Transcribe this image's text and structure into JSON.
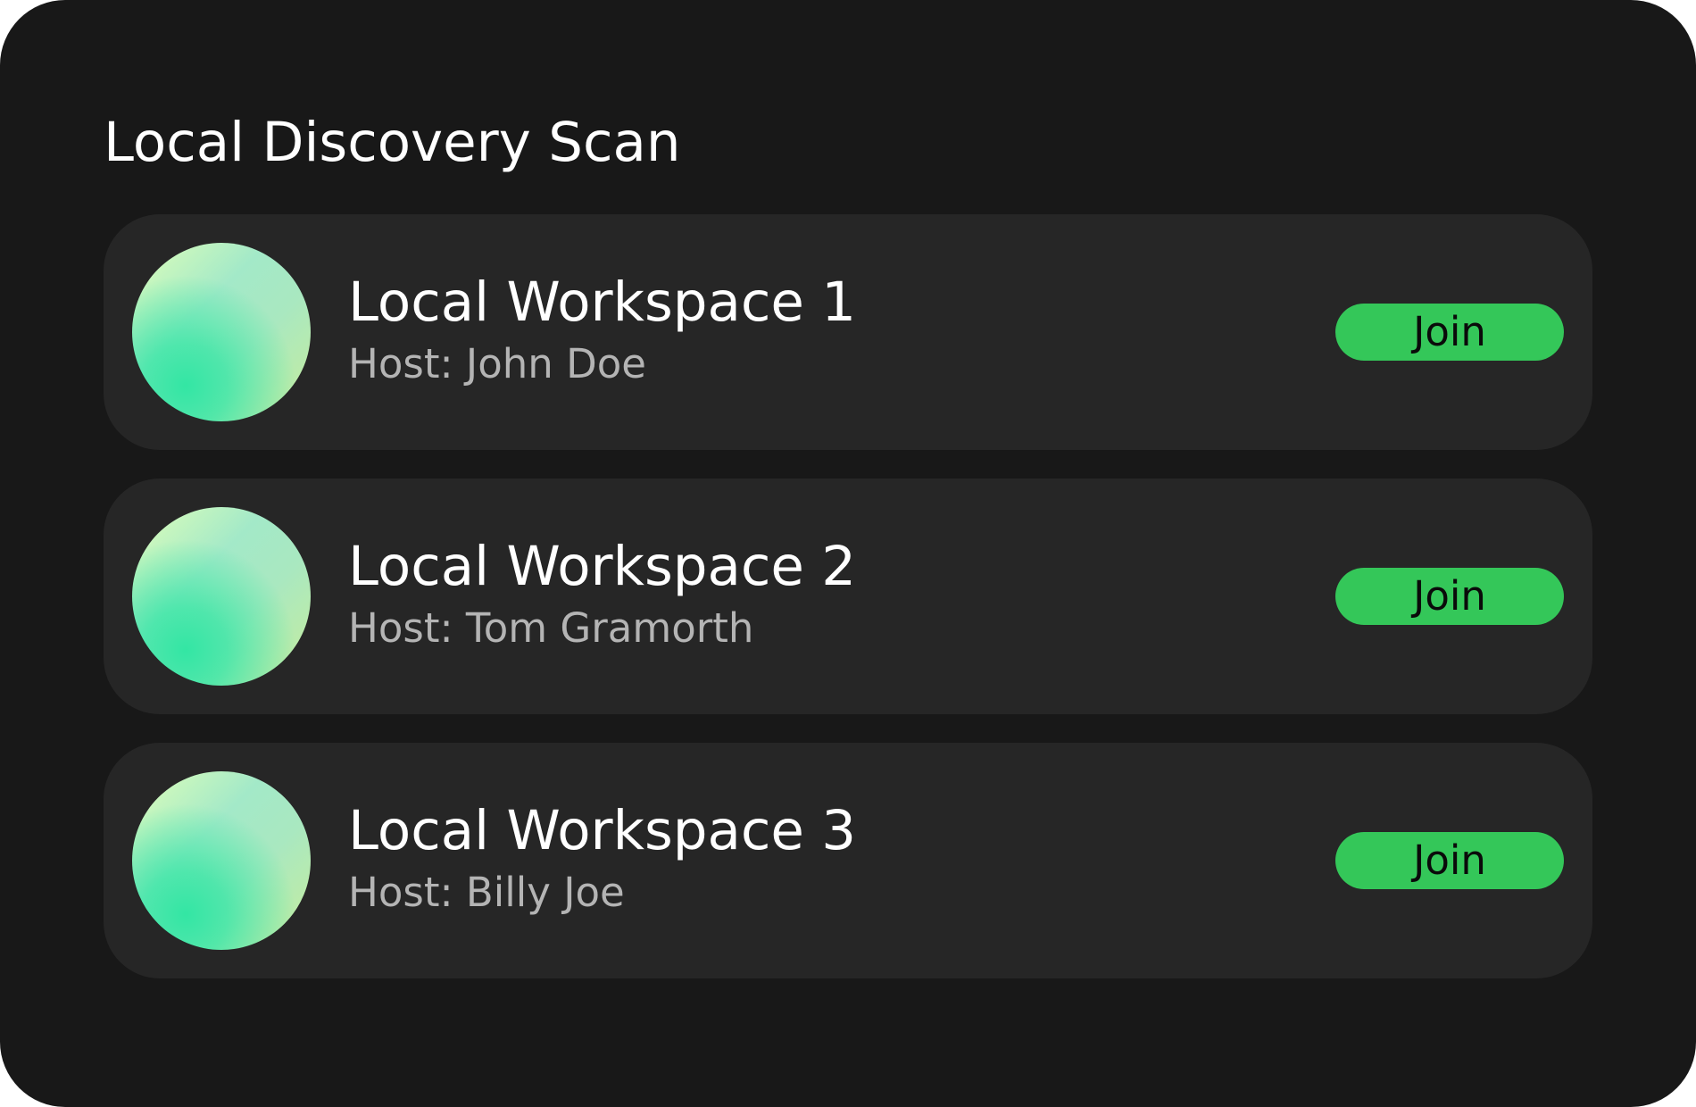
{
  "window": {
    "title": "Local Discovery Scan"
  },
  "workspaces": [
    {
      "name": "Local Workspace 1",
      "host": "Host: John Doe",
      "join_label": "Join"
    },
    {
      "name": "Local Workspace 2",
      "host": "Host: Tom Gramorth",
      "join_label": "Join"
    },
    {
      "name": "Local Workspace 3",
      "host": "Host: Billy Joe",
      "join_label": "Join"
    }
  ],
  "colors": {
    "background": "#181818",
    "card": "#262626",
    "accent": "#34c759",
    "text_primary": "#ffffff",
    "text_secondary": "#b4b4b4"
  }
}
